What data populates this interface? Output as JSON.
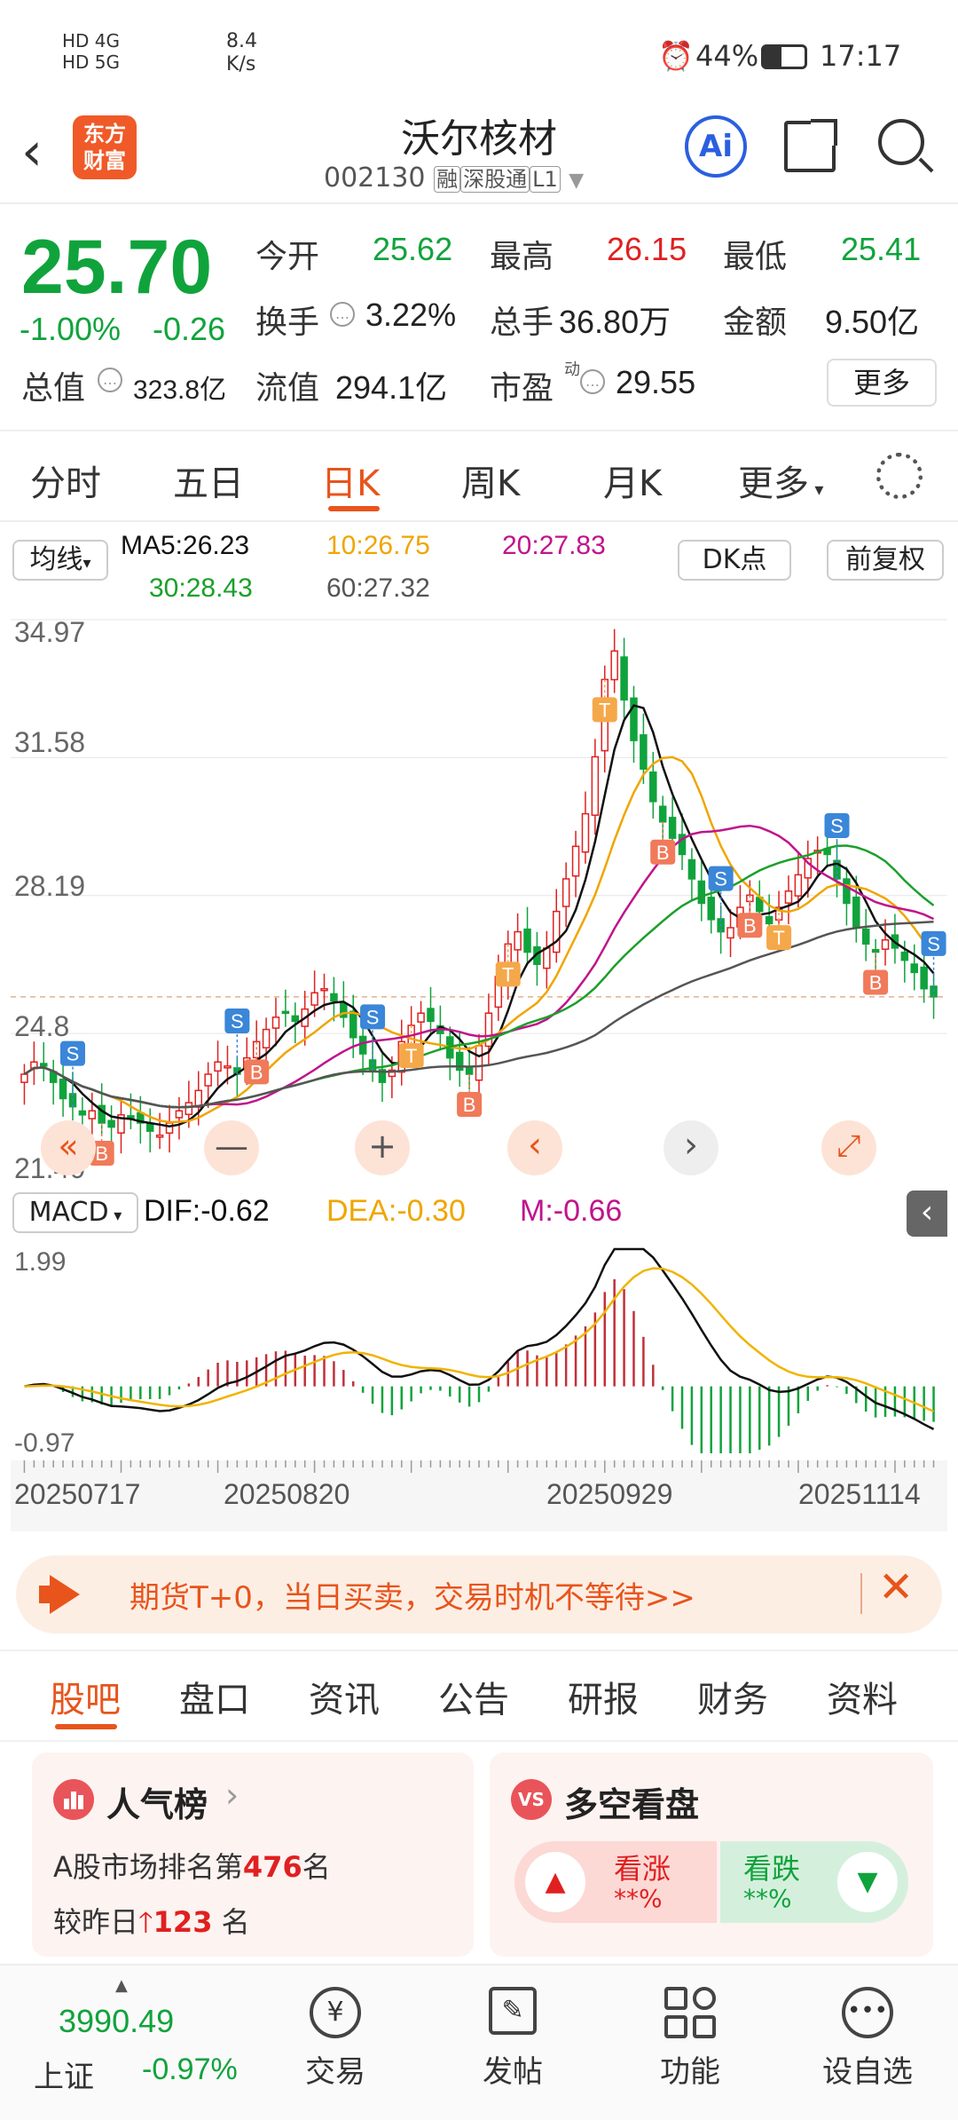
{
  "status_bar": {
    "signal_left": "HD 4G",
    "signal_right": "HD 5G",
    "speed": "8.4",
    "speed_unit": "K/s",
    "battery": "44%",
    "time": "17:17"
  },
  "header": {
    "app_logo_line1": "东方",
    "app_logo_line2": "财富",
    "stock_name": "沃尔核材",
    "stock_code": "002130",
    "tags": [
      "融",
      "深股通",
      "L1"
    ],
    "ai_label": "Ai"
  },
  "quote": {
    "price": "25.70",
    "change_pct": "-1.00%",
    "change": "-0.26",
    "total_value_label": "总值",
    "total_value": "323.8亿",
    "fields": [
      {
        "label": "今开",
        "value": "25.62",
        "color": "#10a33c"
      },
      {
        "label": "最高",
        "value": "26.15",
        "color": "#e02020"
      },
      {
        "label": "最低",
        "value": "25.41",
        "color": "#10a33c"
      },
      {
        "label": "换手",
        "value": "3.22%",
        "color": "#222"
      },
      {
        "label": "总手",
        "value": "36.80万",
        "color": "#222"
      },
      {
        "label": "金额",
        "value": "9.50亿",
        "color": "#222"
      },
      {
        "label": "流值",
        "value": "294.1亿",
        "color": "#222"
      },
      {
        "label": "市盈",
        "value": "29.55",
        "color": "#222"
      }
    ],
    "pe_superscript": "动",
    "more_button": "更多"
  },
  "period_tabs": [
    "分时",
    "五日",
    "日K",
    "周K",
    "月K",
    "更多"
  ],
  "active_period": "日K",
  "ma_row": {
    "ma_select": "均线",
    "ma5": "MA5:26.23",
    "ma10": "10:26.75",
    "ma20": "20:27.83",
    "ma30": "30:28.43",
    "ma60": "60:27.32",
    "dk_button": "DK点",
    "adjust_button": "前复权"
  },
  "chart_data": {
    "type": "candlestick",
    "y_ticks": [
      "34.97",
      "31.58",
      "28.19",
      "24.8",
      "21.40"
    ],
    "ylim": [
      21.4,
      34.97
    ],
    "last_close": 25.7,
    "closes": [
      23.8,
      24.1,
      24.0,
      23.6,
      23.2,
      23.0,
      22.8,
      22.9,
      22.6,
      22.5,
      22.8,
      22.7,
      22.6,
      22.4,
      22.3,
      22.6,
      22.9,
      23.1,
      23.4,
      23.8,
      24.1,
      24.0,
      23.8,
      24.2,
      24.6,
      24.9,
      25.2,
      25.3,
      25.1,
      25.4,
      25.8,
      25.9,
      25.6,
      25.2,
      24.7,
      24.3,
      23.9,
      23.6,
      23.9,
      24.6,
      25.0,
      25.3,
      25.1,
      24.8,
      24.2,
      23.9,
      23.8,
      24.5,
      25.3,
      26.2,
      27.0,
      27.3,
      26.8,
      26.5,
      26.9,
      27.8,
      28.6,
      29.4,
      30.2,
      31.6,
      33.5,
      34.2,
      33.0,
      32.0,
      31.3,
      30.5,
      30.0,
      29.6,
      29.2,
      28.6,
      28.0,
      27.6,
      27.3,
      27.4,
      27.9,
      28.2,
      27.8,
      27.5,
      27.9,
      28.3,
      28.7,
      29.1,
      29.3,
      29.2,
      28.6,
      28.0,
      27.4,
      27.0,
      26.8,
      27.1,
      26.9,
      26.6,
      26.3,
      25.9,
      25.7
    ],
    "ma_series": [
      {
        "name": "MA5",
        "color": "#111111"
      },
      {
        "name": "MA10",
        "color": "#f0a500"
      },
      {
        "name": "MA20",
        "color": "#c0148c"
      },
      {
        "name": "MA30",
        "color": "#1aa02a"
      },
      {
        "name": "MA60",
        "color": "#555555"
      }
    ],
    "markers": [
      {
        "i": 5,
        "t": "S"
      },
      {
        "i": 8,
        "t": "B"
      },
      {
        "i": 22,
        "t": "S"
      },
      {
        "i": 24,
        "t": "B"
      },
      {
        "i": 36,
        "t": "S"
      },
      {
        "i": 40,
        "t": "T"
      },
      {
        "i": 46,
        "t": "B"
      },
      {
        "i": 50,
        "t": "T"
      },
      {
        "i": 60,
        "t": "T"
      },
      {
        "i": 66,
        "t": "B"
      },
      {
        "i": 72,
        "t": "S"
      },
      {
        "i": 75,
        "t": "B"
      },
      {
        "i": 78,
        "t": "T"
      },
      {
        "i": 84,
        "t": "S"
      },
      {
        "i": 88,
        "t": "B"
      },
      {
        "i": 94,
        "t": "S"
      }
    ],
    "macd": {
      "dif": "DIF:-0.62",
      "dea": "DEA:-0.30",
      "m": "M:-0.66",
      "y_top": "1.99",
      "y_bottom": "-0.97",
      "ylim": [
        -0.97,
        1.99
      ]
    },
    "dates": [
      "20250717",
      "20250820",
      "20250929",
      "20251114"
    ]
  },
  "chart_controls": [
    "«",
    "—",
    "+",
    "‹",
    "›",
    "⤢"
  ],
  "banner": {
    "text": "期货T+0，当日买卖，交易时机不等待>>"
  },
  "content_tabs": [
    "股吧",
    "盘口",
    "资讯",
    "公告",
    "研报",
    "财务",
    "资料"
  ],
  "active_content_tab": "股吧",
  "popularity_card": {
    "title": "人气榜",
    "line1_prefix": "A股市场排名第",
    "rank": "476",
    "line1_suffix": "名",
    "line2_prefix": "较昨日",
    "change": "123",
    "line2_suffix": "名"
  },
  "bullbear_card": {
    "title": "多空看盘",
    "bull_label": "看涨",
    "bull_value": "**%",
    "bear_label": "看跌",
    "bear_value": "**%"
  },
  "bottom_bar": {
    "index_value": "3990.49",
    "index_name": "上证",
    "index_change": "-0.97%",
    "items": [
      "交易",
      "发帖",
      "功能",
      "设自选"
    ]
  }
}
